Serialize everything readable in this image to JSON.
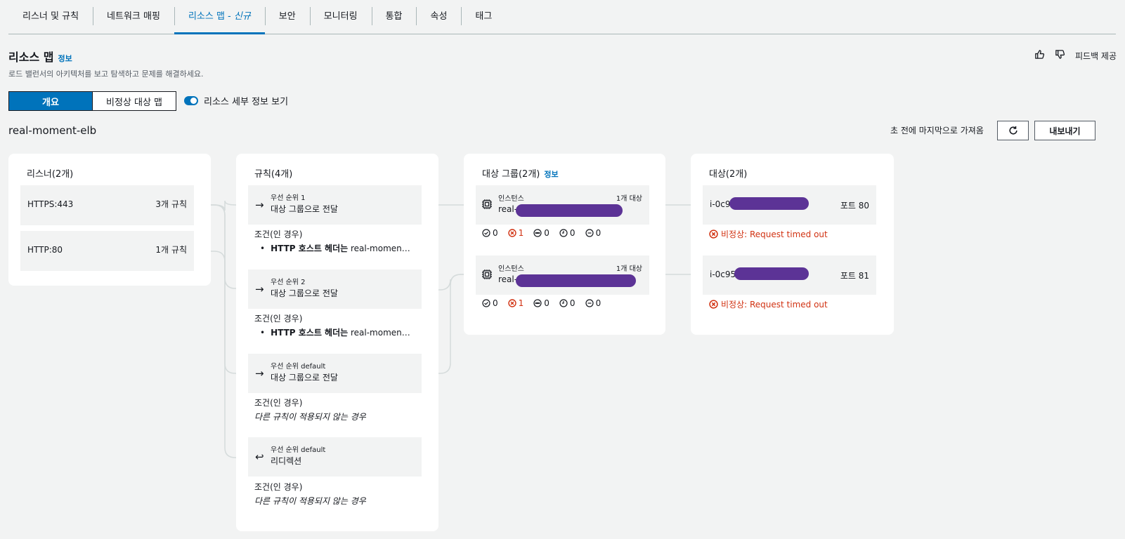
{
  "tabs": [
    {
      "label": "리스너 및 규칙"
    },
    {
      "label": "네트워크 매핑"
    },
    {
      "label": "리소스 맵 - ",
      "new": "신규"
    },
    {
      "label": "보안"
    },
    {
      "label": "모니터링"
    },
    {
      "label": "통합"
    },
    {
      "label": "속성"
    },
    {
      "label": "태그"
    }
  ],
  "header": {
    "title": "리소스 맵",
    "info": "정보",
    "description": "로드 밸런서의 아키텍처를 보고 탐색하고 문제를 해결하세요.",
    "feedback": "피드백 제공"
  },
  "view": {
    "overview": "개요",
    "unhealthy_map": "비정상 대상 맵",
    "toggle_label": "리소스 세부 정보 보기"
  },
  "lb": {
    "name": "real-moment-elb",
    "fetched": "초 전에 마지막으로 가져옴",
    "export": "내보내기"
  },
  "listeners": {
    "title": "리스너(2개)",
    "items": [
      {
        "label": "HTTPS:443",
        "count": "3개 규칙"
      },
      {
        "label": "HTTP:80",
        "count": "1개 규칙"
      }
    ]
  },
  "rules": {
    "title": "규칙(4개)",
    "items": [
      {
        "priority": "우선 순위 1",
        "action": "대상 그룹으로 전달",
        "cond_title": "조건(인 경우)",
        "cond_bold": "HTTP 호스트 헤더는",
        "cond_text": " real-momen…"
      },
      {
        "priority": "우선 순위 2",
        "action": "대상 그룹으로 전달",
        "cond_title": "조건(인 경우)",
        "cond_bold": "HTTP 호스트 헤더는",
        "cond_text": " real-momen…"
      },
      {
        "priority": "우선 순위 default",
        "action": "대상 그룹으로 전달",
        "cond_title": "조건(인 경우)",
        "cond_italic": "다른 규칙이 적용되지 않는 경우"
      },
      {
        "priority": "우선 순위 default",
        "action": "리디렉션",
        "cond_title": "조건(인 경우)",
        "cond_italic": "다른 규칙이 적용되지 않는 경우"
      }
    ]
  },
  "target_groups": {
    "title": "대상 그룹(2개)",
    "info": "정보",
    "items": [
      {
        "type": "인스턴스",
        "count": "1개 대상",
        "name": "real-",
        "stats": [
          "0",
          "1",
          "0",
          "0",
          "0"
        ]
      },
      {
        "type": "인스턴스",
        "count": "1개 대상",
        "name": "real-",
        "stats": [
          "0",
          "1",
          "0",
          "0",
          "0"
        ]
      }
    ]
  },
  "targets": {
    "title": "대상(2개)",
    "items": [
      {
        "id": "i-0c9",
        "port": "포트 80",
        "status": "비정상: Request timed out"
      },
      {
        "id": "i-0c95",
        "port": "포트 81",
        "status": "비정상: Request timed out"
      }
    ]
  },
  "colors": {
    "accent": "#0073bb",
    "error": "#d13212",
    "redaction": "#5c3396"
  }
}
